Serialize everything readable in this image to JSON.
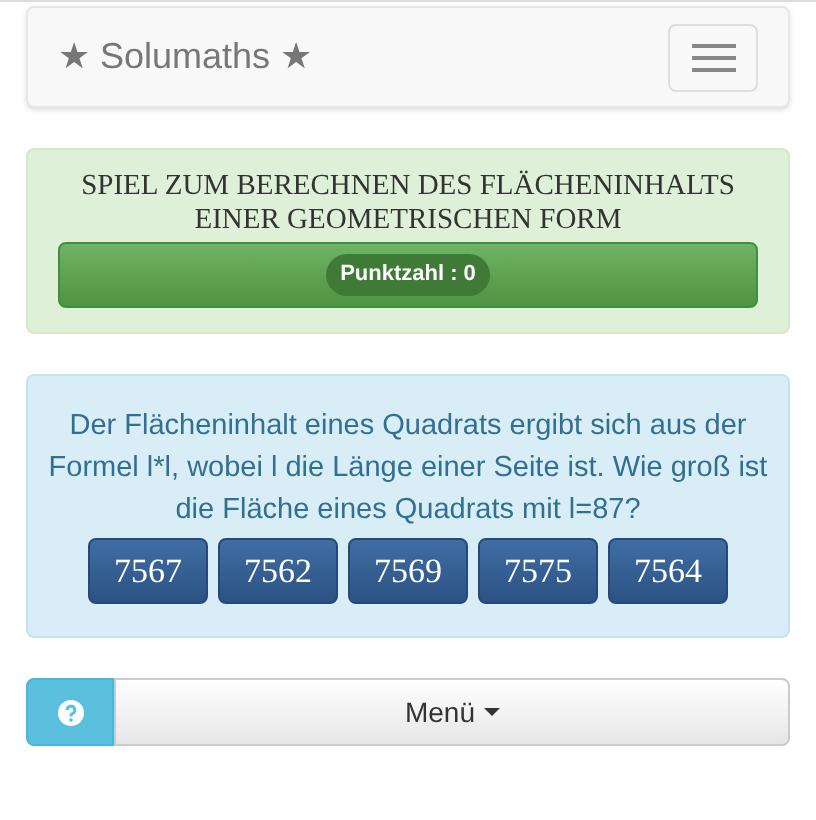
{
  "navbar": {
    "brand": "★ Solumaths ★"
  },
  "game": {
    "title": "SPIEL ZUM BERECHNEN DES FLÄCHENINHALTS EINER GEOMETRISCHEN FORM",
    "score": "Punktzahl : 0"
  },
  "question": {
    "text": "Der Flächeninhalt eines Quadrats ergibt sich aus der Formel l*l, wobei l die Länge einer Seite ist. Wie groß ist die Fläche eines Quadrats mit l=87?",
    "answers": [
      "7567",
      "7562",
      "7569",
      "7575",
      "7564"
    ]
  },
  "menu": {
    "label": "Menü"
  }
}
